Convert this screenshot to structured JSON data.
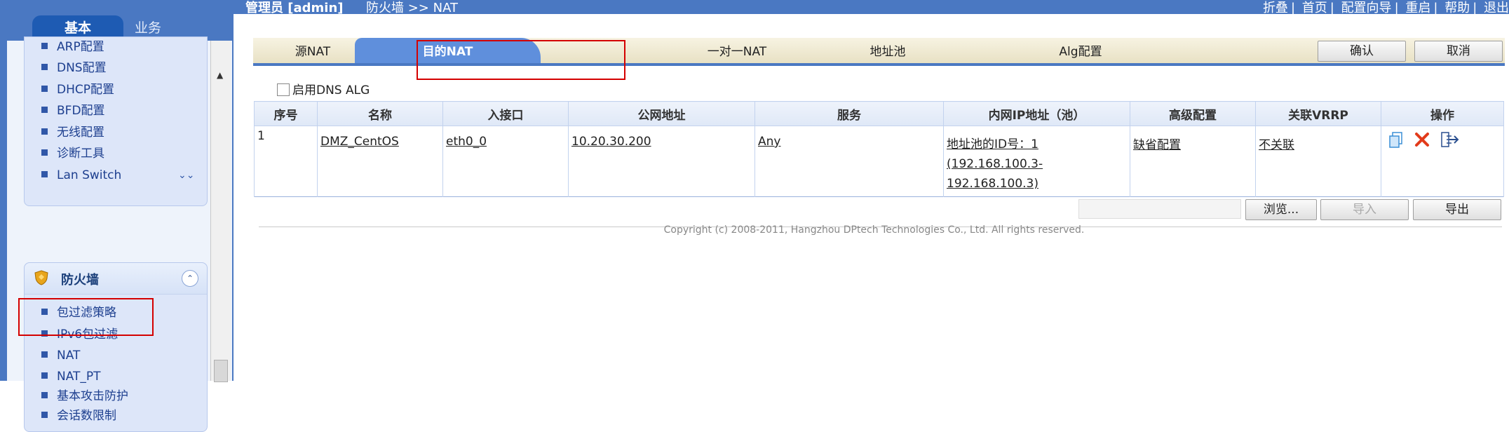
{
  "topbar": {
    "user": "管理员  [admin]",
    "breadcrumb": "防火墙  >> NAT",
    "links": [
      "折叠",
      "首页",
      "配置向导",
      "重启",
      "帮助",
      "退出"
    ]
  },
  "sidebar": {
    "tabs": [
      {
        "label": "基本",
        "active": true
      },
      {
        "label": "业务",
        "active": false
      }
    ],
    "panel1_items": [
      {
        "label": "ARP配置"
      },
      {
        "label": "DNS配置"
      },
      {
        "label": "DHCP配置"
      },
      {
        "label": "BFD配置"
      },
      {
        "label": "无线配置"
      },
      {
        "label": "诊断工具"
      },
      {
        "label": "Lan Switch"
      }
    ],
    "firewall": {
      "title": "防火墙",
      "items": [
        {
          "label": "包过滤策略"
        },
        {
          "label": "IPv6包过滤"
        },
        {
          "label": "NAT"
        },
        {
          "label": "NAT_PT"
        },
        {
          "label": "基本攻击防护"
        },
        {
          "label": "会话数限制"
        }
      ]
    }
  },
  "tabs": [
    {
      "label": "源NAT",
      "active": false
    },
    {
      "label": "目的NAT",
      "active": true
    },
    {
      "label": "一对一NAT",
      "active": false
    },
    {
      "label": "地址池",
      "active": false
    },
    {
      "label": "Alg配置",
      "active": false
    }
  ],
  "actions": {
    "confirm": "确认",
    "cancel": "取消"
  },
  "dns_alg": {
    "label": "启用DNS ALG",
    "checked": false
  },
  "table": {
    "headers": [
      "序号",
      "名称",
      "入接口",
      "公网地址",
      "服务",
      "内网IP地址（池）",
      "高级配置",
      "关联VRRP",
      "操作"
    ],
    "rows": [
      {
        "index": "1",
        "name": "DMZ_CentOS",
        "in_if": "eth0_0",
        "public_addr": "10.20.30.200",
        "service": "Any",
        "pool_line1": "地址池的ID号：1",
        "pool_line2": "(192.168.100.3-192.168.100.3)",
        "advanced": "缺省配置",
        "vrrp": "不关联",
        "ops": [
          "copy-icon",
          "delete-icon",
          "move-icon"
        ]
      }
    ]
  },
  "import": {
    "browse": "浏览...",
    "import": "导入",
    "export": "导出"
  },
  "copyright": "Copyright (c) 2008-2011, Hangzhou DPtech Technologies Co., Ltd. All rights reserved.",
  "colors": {
    "header_blue": "#4a78c2",
    "tab_active": "#5f8fdc",
    "highlight_red": "#d40000"
  }
}
